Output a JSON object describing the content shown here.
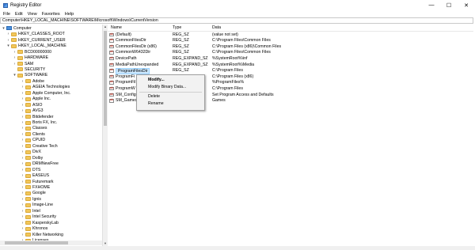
{
  "window": {
    "title": "Registry Editor",
    "minimize": "—",
    "maximize": "☐",
    "close": "✕"
  },
  "menu": [
    "File",
    "Edit",
    "View",
    "Favorites",
    "Help"
  ],
  "address": "Computer\\HKEY_LOCAL_MACHINE\\SOFTWARE\\Microsoft\\Windows\\CurrentVersion",
  "tree": [
    {
      "label": "Computer",
      "icon": "computer-icon",
      "expander": "▾",
      "level": 0
    },
    {
      "label": "HKEY_CLASSES_ROOT",
      "icon": "folder-icon",
      "expander": "›",
      "level": 1
    },
    {
      "label": "HKEY_CURRENT_USER",
      "icon": "folder-icon",
      "expander": "›",
      "level": 1
    },
    {
      "label": "HKEY_LOCAL_MACHINE",
      "icon": "folder-icon",
      "expander": "▾",
      "level": 1
    },
    {
      "label": "BCD00000000",
      "icon": "folder-icon",
      "expander": "›",
      "level": 2
    },
    {
      "label": "HARDWARE",
      "icon": "folder-icon",
      "expander": "›",
      "level": 2
    },
    {
      "label": "SAM",
      "icon": "folder-icon",
      "expander": "›",
      "level": 2
    },
    {
      "label": "SECURITY",
      "icon": "folder-icon",
      "expander": "",
      "level": 2
    },
    {
      "label": "SOFTWARE",
      "icon": "folder-icon",
      "expander": "▾",
      "level": 2
    },
    {
      "label": "Adobe",
      "icon": "folder-icon",
      "expander": "›",
      "level": 3
    },
    {
      "label": "AGEIA Technologies",
      "icon": "folder-icon",
      "expander": "›",
      "level": 3
    },
    {
      "label": "Apple Computer, Inc.",
      "icon": "folder-icon",
      "expander": "›",
      "level": 3
    },
    {
      "label": "Apple Inc.",
      "icon": "folder-icon",
      "expander": "›",
      "level": 3
    },
    {
      "label": "ASIO",
      "icon": "folder-icon",
      "expander": "›",
      "level": 3
    },
    {
      "label": "AVG3",
      "icon": "folder-icon",
      "expander": "›",
      "level": 3
    },
    {
      "label": "Bitdefender",
      "icon": "folder-icon",
      "expander": "›",
      "level": 3
    },
    {
      "label": "Boris FX, Inc.",
      "icon": "folder-icon",
      "expander": "›",
      "level": 3
    },
    {
      "label": "Classes",
      "icon": "folder-icon",
      "expander": "›",
      "level": 3
    },
    {
      "label": "Clients",
      "icon": "folder-icon",
      "expander": "›",
      "level": 3
    },
    {
      "label": "CPUID",
      "icon": "folder-icon",
      "expander": "›",
      "level": 3
    },
    {
      "label": "Creative Tech",
      "icon": "folder-icon",
      "expander": "›",
      "level": 3
    },
    {
      "label": "DivX",
      "icon": "folder-icon",
      "expander": "›",
      "level": 3
    },
    {
      "label": "Dolby",
      "icon": "folder-icon",
      "expander": "›",
      "level": 3
    },
    {
      "label": "DRMNewFree",
      "icon": "folder-icon",
      "expander": "›",
      "level": 3
    },
    {
      "label": "DTS",
      "icon": "folder-icon",
      "expander": "›",
      "level": 3
    },
    {
      "label": "EASEUS",
      "icon": "folder-icon",
      "expander": "›",
      "level": 3
    },
    {
      "label": "Futuremark",
      "icon": "folder-icon",
      "expander": "›",
      "level": 3
    },
    {
      "label": "FXHOME",
      "icon": "folder-icon",
      "expander": "›",
      "level": 3
    },
    {
      "label": "Google",
      "icon": "folder-icon",
      "expander": "›",
      "level": 3
    },
    {
      "label": "Ignis",
      "icon": "folder-icon",
      "expander": "›",
      "level": 3
    },
    {
      "label": "Image-Line",
      "icon": "folder-icon",
      "expander": "›",
      "level": 3
    },
    {
      "label": "Intel",
      "icon": "folder-icon",
      "expander": "›",
      "level": 3
    },
    {
      "label": "Intel Security",
      "icon": "folder-icon",
      "expander": "›",
      "level": 3
    },
    {
      "label": "KasperskyLab",
      "icon": "folder-icon",
      "expander": "›",
      "level": 3
    },
    {
      "label": "Khronos",
      "icon": "folder-icon",
      "expander": "›",
      "level": 3
    },
    {
      "label": "Killer Networking",
      "icon": "folder-icon",
      "expander": "›",
      "level": 3
    },
    {
      "label": "Licenses",
      "icon": "folder-icon",
      "expander": "›",
      "level": 3
    }
  ],
  "columns": {
    "name": "Name",
    "type": "Type",
    "data": "Data"
  },
  "values": [
    {
      "name": "(Default)",
      "type": "REG_SZ",
      "data": "(value not set)"
    },
    {
      "name": "CommonFilesDir",
      "type": "REG_SZ",
      "data": "C:\\Program Files\\Common Files"
    },
    {
      "name": "CommonFilesDir (x86)",
      "type": "REG_SZ",
      "data": "C:\\Program Files (x86)\\Common Files"
    },
    {
      "name": "CommonW6432Dir",
      "type": "REG_SZ",
      "data": "C:\\Program Files\\Common Files"
    },
    {
      "name": "DevicePath",
      "type": "REG_EXPAND_SZ",
      "data": "%SystemRoot%\\inf"
    },
    {
      "name": "MediaPathUnexpanded",
      "type": "REG_EXPAND_SZ",
      "data": "%SystemRoot%\\Media"
    },
    {
      "name": "ProgramFilesDir",
      "type": "REG_SZ",
      "data": "C:\\Program Files"
    },
    {
      "name": "ProgramFi",
      "type": "REG_SZ",
      "data": "C:\\Program Files (x86)"
    },
    {
      "name": "ProgramFil",
      "type": "REG_SZ",
      "data": "%ProgramFiles%"
    },
    {
      "name": "ProgramW",
      "type": "REG_SZ",
      "data": "C:\\Program Files"
    },
    {
      "name": "SM_Configu",
      "type": "REG_SZ",
      "data": "Set Program Access and Defaults"
    },
    {
      "name": "SM_Gamesi",
      "type": "REG_SZ",
      "data": "Games"
    }
  ],
  "selected_value_index": 6,
  "context_menu": {
    "modify": "Modify...",
    "modify_binary": "Modify Binary Data...",
    "delete": "Delete",
    "rename": "Rename"
  }
}
